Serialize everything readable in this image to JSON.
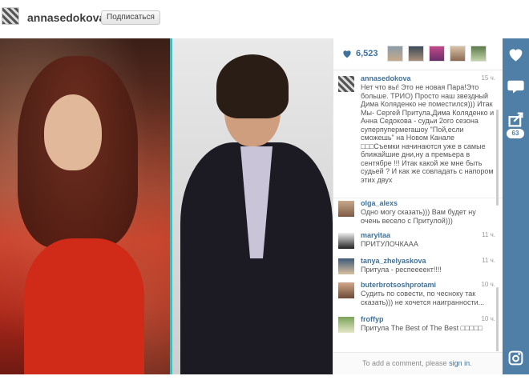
{
  "header": {
    "username": "annasedokova",
    "follow_label": "Подписаться"
  },
  "post": {
    "likes": "6,523",
    "comment_count": "63"
  },
  "comments": [
    {
      "user": "annasedokova",
      "time": "15 ч.",
      "text": "Нет что вы! Это не новая Пара!Это больше. ТРИО) Просто наш звездный Дима Коляденко не поместился))) Итак Мы- Сергей Притула,Дима Коляденко и Анна Седокова - судьи 2ого сезона суперпупермегашоу \"Пой,если сможешь\" на Новом Канале □□□Съемки начинаются уже в самые ближайшие дни,ну а премьера в сентябре !!! Итак какой же мне быть судьей ? И как же совладать с напором этих двух"
    },
    {
      "user": "olga_alexs",
      "time": "",
      "text": "Одно могу сказать))) Вам будет ну очень весело с Притулой)))"
    },
    {
      "user": "maryitaa",
      "time": "11 ч.",
      "text": "ПРИТУЛОЧКААА"
    },
    {
      "user": "tanya_zhelyaskova",
      "time": "11 ч.",
      "text": "Притула - респеееект!!!!"
    },
    {
      "user": "buterbrotsoshprotami",
      "time": "10 ч.",
      "text": "Судить по совести, по чесноку так сказать))) не хочется наигранности..."
    },
    {
      "user": "froffyp",
      "time": "10 ч.",
      "text": "Притула The Best of The Best □□□□□"
    }
  ],
  "add_comment": {
    "prefix": "To add a comment, please",
    "link": "sign in",
    "suffix": "."
  },
  "icons": {
    "like": "heart-icon",
    "comment": "speech-bubble-icon",
    "share": "share-icon",
    "instagram": "instagram-logo"
  },
  "colors": {
    "accent": "#3f729b",
    "rail": "#4f7fa6",
    "divider": "#47b8b8"
  }
}
